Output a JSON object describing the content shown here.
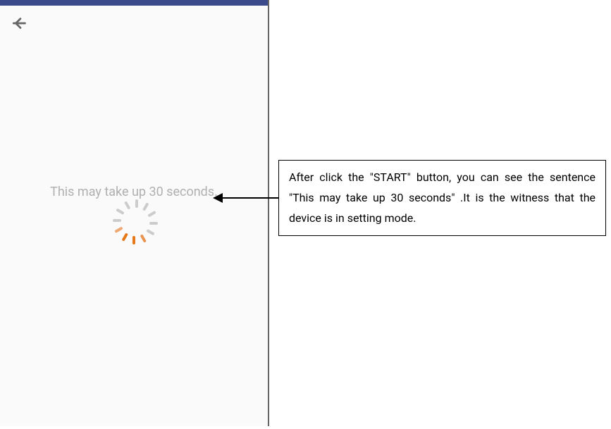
{
  "phone": {
    "loading_message": "This may take up 30 seconds.",
    "back_icon": "back-arrow-icon"
  },
  "annotation": {
    "text": "After click the \"START\" button, you can see the sentence \"This may take up 30 seconds\" .It is the witness that the device is in setting mode."
  },
  "spinner": {
    "blade_count": 12,
    "active_color": "#e67817",
    "inactive_color": "#cccccc"
  }
}
